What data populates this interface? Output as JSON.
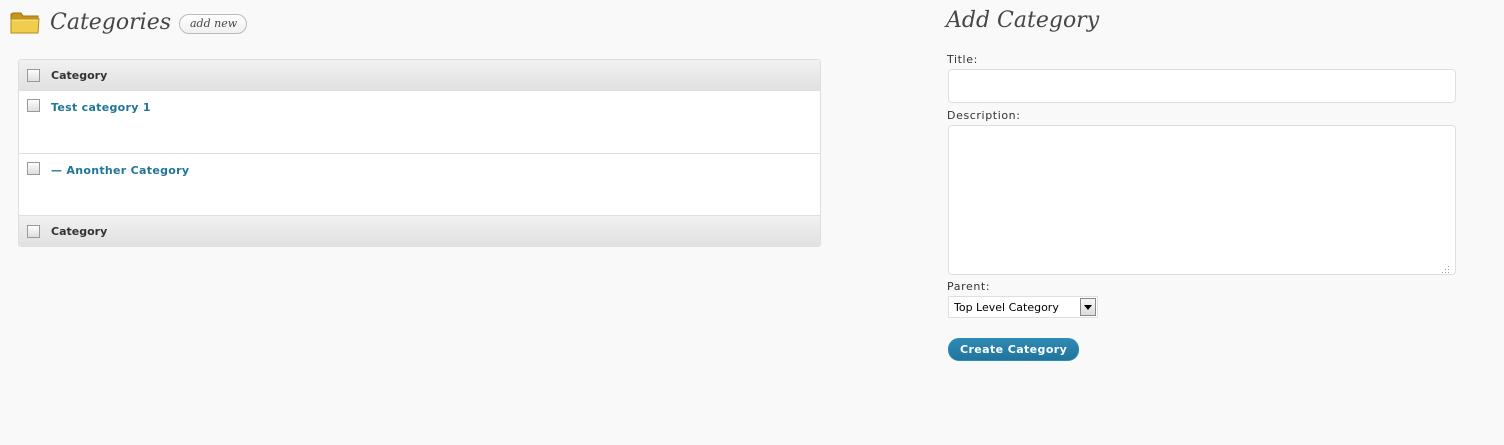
{
  "categories_panel": {
    "title": "Categories",
    "add_new_label": "add new",
    "column_header": "Category",
    "column_footer": "Category",
    "rows": [
      {
        "label": "Test category 1"
      },
      {
        "label": "— Anonther Category"
      }
    ]
  },
  "add_form": {
    "title": "Add Category",
    "title_label": "Title:",
    "title_value": "",
    "description_label": "Description:",
    "description_value": "",
    "parent_label": "Parent:",
    "parent_selected": "Top Level Category",
    "submit_label": "Create Category"
  },
  "icons": {
    "folder": "folder-icon",
    "dropdown": "chevron-down-icon",
    "resize": "resize-handle-icon"
  },
  "colors": {
    "link": "#21759b",
    "button_primary": "#21759b",
    "background": "#f9f9f9",
    "folder": "#e8b724"
  }
}
